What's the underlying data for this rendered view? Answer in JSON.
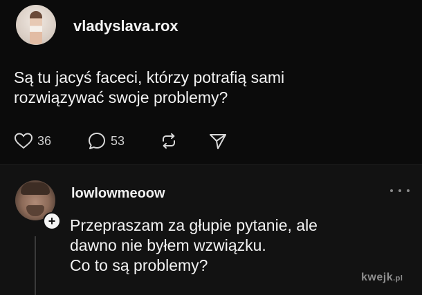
{
  "post": {
    "username": "vladyslava.rox",
    "text_line1": "Są tu jacyś faceci, którzy potrafią sami",
    "text_line2": "rozwiązywać swoje problemy?",
    "likes": "36",
    "comments": "53",
    "icons": [
      "heart-icon",
      "comment-bubble-icon",
      "repost-icon",
      "share-icon"
    ]
  },
  "reply": {
    "username": "lowlowmeoow",
    "text_line1": "Przepraszam za głupie pytanie, ale",
    "text_line2": "dawno nie byłem wzwiązku.",
    "text_line3": "Co to są problemy?",
    "badge": "+",
    "icons": [
      "more-options-icon"
    ]
  },
  "watermark": {
    "main": "kwejk",
    "suffix": ".pl"
  },
  "colors": {
    "background": "#0b0b0b",
    "reply_background": "#121212",
    "text": "#f2f2f2",
    "secondary_text": "#cfcfcf",
    "thread_line": "#3a3a3a"
  }
}
